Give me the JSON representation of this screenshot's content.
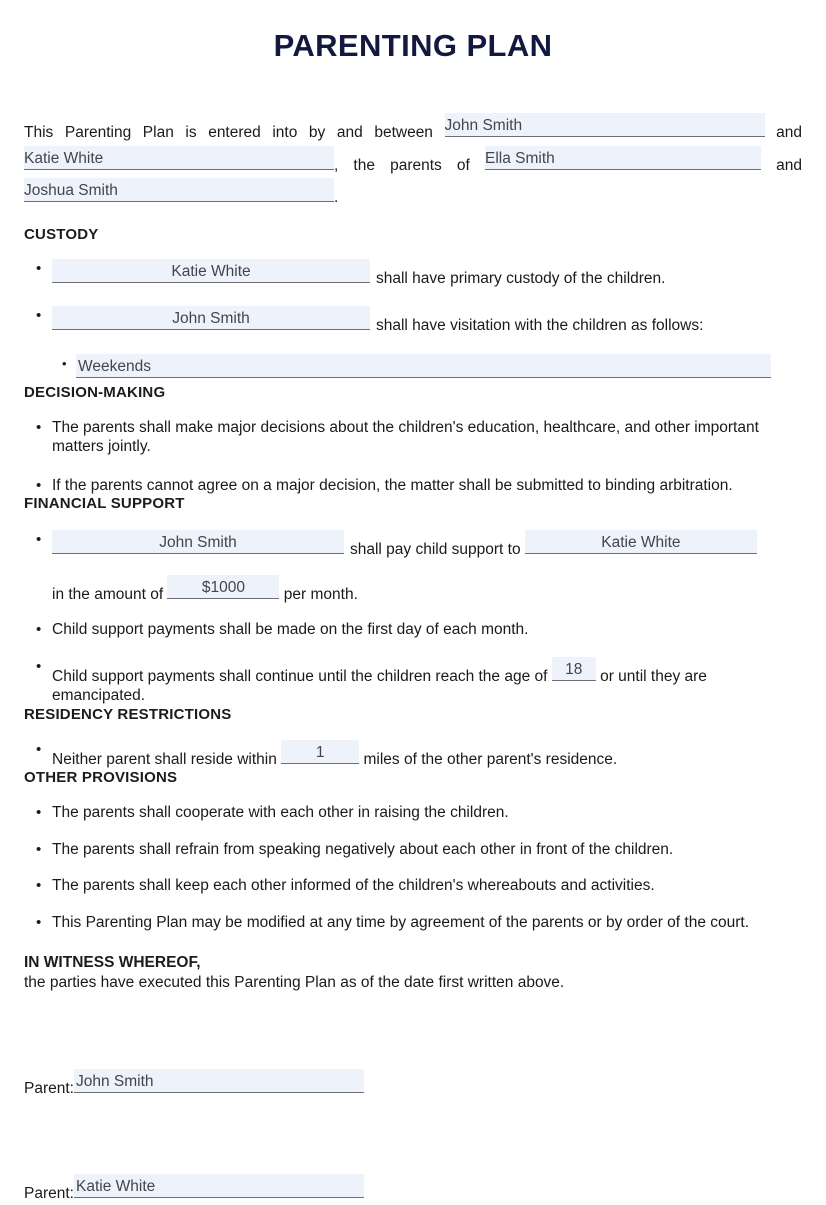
{
  "document": {
    "title": "PARENTING PLAN",
    "title_color": "#13183f",
    "field_bg_color": "#eef2fa",
    "field_text_color": "#44444e"
  },
  "intro": {
    "t1": "This Parenting Plan is entered into by and between",
    "parent1": "John Smith",
    "t2": "and",
    "parent2": "Katie White",
    "t3": ", the parents of",
    "child1": "Ella Smith",
    "t4": "and",
    "child2": "Joshua Smith",
    "t5": "."
  },
  "custody": {
    "heading": "CUSTODY",
    "item1_field": "Katie White",
    "item1_text": "shall have primary custody of the children.",
    "item2_field": "John Smith",
    "item2_text": "shall have visitation with the children as follows:",
    "sub1_field": "Weekends"
  },
  "decision_making": {
    "heading": "DECISION-MAKING",
    "items": [
      "The parents shall make major decisions about the children's education, healthcare, and other important matters jointly.",
      "If the parents cannot agree on a major decision, the matter shall be submitted to binding arbitration."
    ]
  },
  "financial_support": {
    "heading": "FINANCIAL SUPPORT",
    "payer": "John Smith",
    "pay_text": "shall pay child support to",
    "payee": "Katie White",
    "amount_prefix": "in the amount of",
    "amount": "$1000",
    "amount_suffix": "per month.",
    "item2": "Child support payments shall be made on the first day of each month.",
    "item3_prefix": "Child support payments shall continue until the children reach the age of",
    "age": "18",
    "item3_suffix": "or until they are emancipated."
  },
  "residency": {
    "heading": "RESIDENCY RESTRICTIONS",
    "item_prefix": "Neither parent shall reside within",
    "miles": "1",
    "item_suffix": "miles of the other parent's residence."
  },
  "other_provisions": {
    "heading": "OTHER PROVISIONS",
    "items": [
      "The parents shall cooperate with each other in raising the children.",
      "The parents shall refrain from speaking negatively about each other in front of the children.",
      "The parents shall keep each other informed of the children's whereabouts and activities.",
      "This Parenting Plan may be modified at any time by agreement of the parents or by order of the court."
    ]
  },
  "witness": {
    "heading": "IN WITNESS WHEREOF,",
    "text": "the parties have executed this Parenting Plan as of the date first written above."
  },
  "signatures": {
    "label1": "Parent:",
    "value1": "John Smith",
    "label2": "Parent:",
    "value2": "Katie White"
  }
}
